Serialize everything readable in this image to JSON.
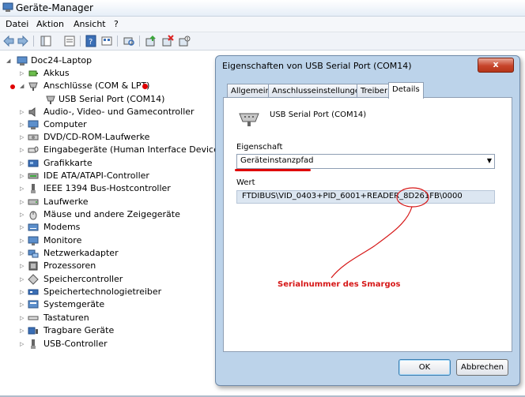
{
  "window": {
    "title": "Geräte-Manager"
  },
  "menu": [
    "Datei",
    "Aktion",
    "Ansicht",
    "?"
  ],
  "tree": {
    "root": "Doc24-Laptop",
    "items": [
      "Akkus",
      "Anschlüsse (COM & LPT)",
      "USB Serial Port (COM14)",
      "Audio-, Video- und Gamecontroller",
      "Computer",
      "DVD/CD-ROM-Laufwerke",
      "Eingabegeräte (Human Interface Devices)",
      "Grafikkarte",
      "IDE ATA/ATAPI-Controller",
      "IEEE 1394 Bus-Hostcontroller",
      "Laufwerke",
      "Mäuse und andere Zeigegeräte",
      "Modems",
      "Monitore",
      "Netzwerkadapter",
      "Prozessoren",
      "Speichercontroller",
      "Speichertechnologietreiber",
      "Systemgeräte",
      "Tastaturen",
      "Tragbare Geräte",
      "USB-Controller"
    ]
  },
  "dialog": {
    "title": "Eigenschaften von USB Serial Port (COM14)",
    "close_label": "x",
    "tabs": [
      "Allgemein",
      "Anschlusseinstellungen",
      "Treiber",
      "Details"
    ],
    "device_name": "USB Serial Port (COM14)",
    "property_label": "Eigenschaft",
    "property_value": "Geräteinstanzpfad",
    "value_label": "Wert",
    "value_text": "FTDIBUS\\VID_0403+PID_6001+READER_8D261FB\\0000",
    "ok_label": "OK",
    "cancel_label": "Abbrechen"
  },
  "annotation": {
    "text": "Serialnummer des Smargos",
    "color": "#d61717"
  }
}
